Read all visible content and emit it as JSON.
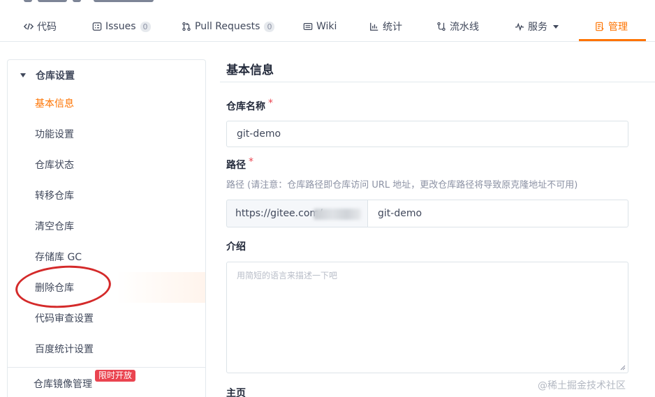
{
  "tabs": [
    {
      "label": "代码",
      "icon": "code-icon"
    },
    {
      "label": "Issues",
      "icon": "issues-icon",
      "count": "0"
    },
    {
      "label": "Pull Requests",
      "icon": "pull-request-icon",
      "count": "0"
    },
    {
      "label": "Wiki",
      "icon": "wiki-icon"
    },
    {
      "label": "统计",
      "icon": "stats-icon"
    },
    {
      "label": "流水线",
      "icon": "pipeline-icon"
    },
    {
      "label": "服务",
      "icon": "service-icon"
    },
    {
      "label": "管理",
      "icon": "manage-icon",
      "active": true
    }
  ],
  "sidebar": {
    "group_label": "仓库设置",
    "items": [
      {
        "label": "基本信息",
        "active": true
      },
      {
        "label": "功能设置"
      },
      {
        "label": "仓库状态"
      },
      {
        "label": "转移仓库"
      },
      {
        "label": "清空仓库"
      },
      {
        "label": "存储库 GC"
      },
      {
        "label": "删除仓库",
        "highlighted": true
      },
      {
        "label": "代码审查设置"
      },
      {
        "label": "百度统计设置"
      }
    ],
    "bottom_item": "仓库镜像管理",
    "bottom_badge": "限时开放"
  },
  "main": {
    "title": "基本信息",
    "repo_name": {
      "label": "仓库名称",
      "required": "*",
      "value": "git-demo"
    },
    "path": {
      "label": "路径",
      "required": "*",
      "hint": "路径 (请注意：仓库路径即仓库访问 URL 地址，更改仓库路径将导致原克隆地址不可用)",
      "prefix": "https://gitee.com/",
      "value": "git-demo"
    },
    "intro": {
      "label": "介绍",
      "placeholder": "用简短的语言来描述一下吧"
    },
    "homepage": {
      "label": "主页"
    }
  },
  "watermark": "@稀土掘金技术社区",
  "colors": {
    "accent": "#fe7300",
    "required": "#ea4450",
    "annotation": "#d42a2a",
    "badge": "#ea4450"
  }
}
